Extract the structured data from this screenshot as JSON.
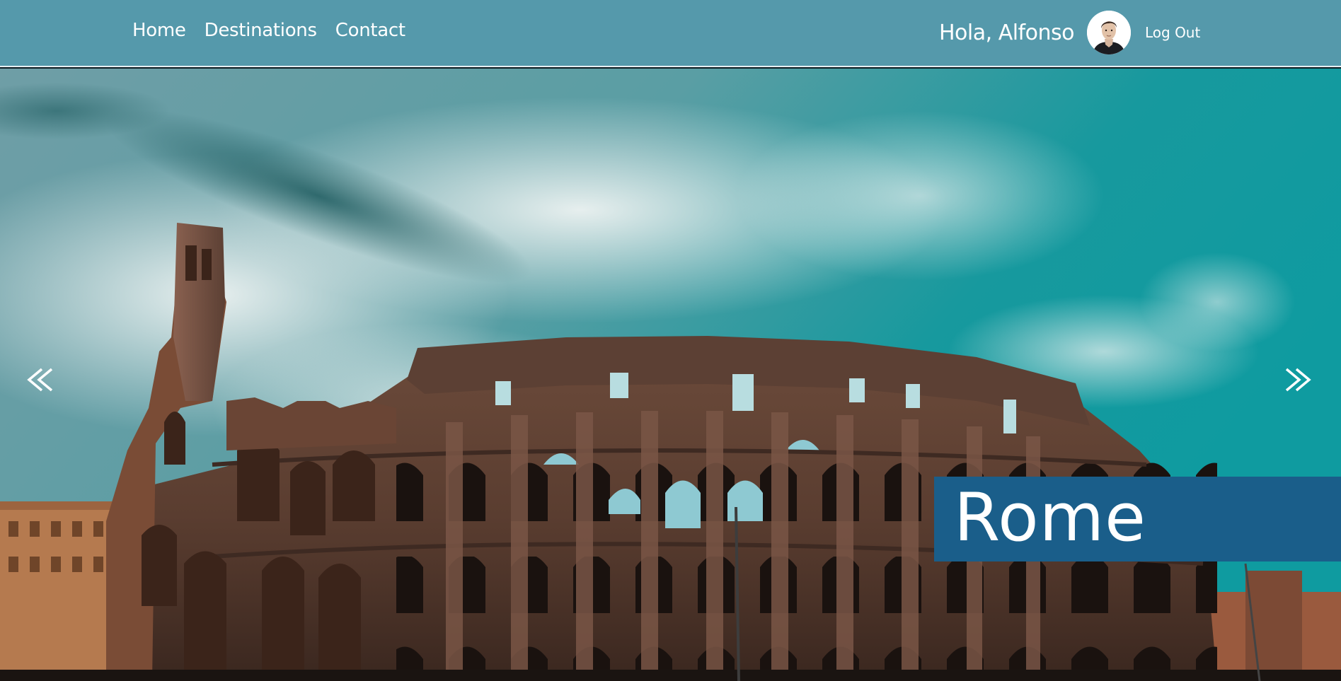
{
  "nav": {
    "items": [
      "Home",
      "Destinations",
      "Contact"
    ]
  },
  "user": {
    "greeting": "Hola, Alfonso",
    "avatar_icon": "user-avatar-icon",
    "logout_label": "Log Out"
  },
  "hero": {
    "caption": "Rome",
    "prev_icon": "chevron-double-left-icon",
    "next_icon": "chevron-double-right-icon"
  },
  "colors": {
    "header_bg": "#5599ab",
    "caption_bg": "#1a5e8a",
    "text": "#ffffff"
  }
}
